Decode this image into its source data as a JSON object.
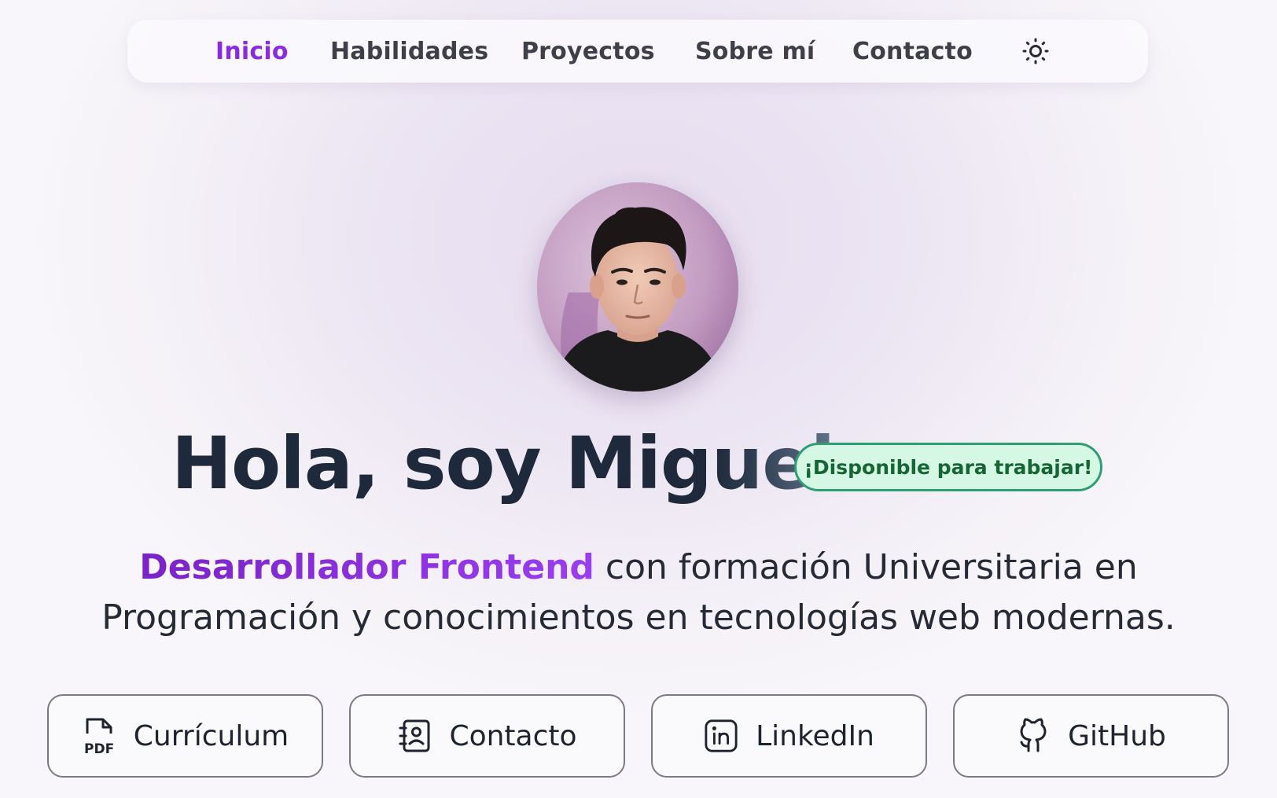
{
  "nav": {
    "items": [
      {
        "label": "Inicio",
        "active": true
      },
      {
        "label": "Habilidades",
        "active": false
      },
      {
        "label": "Proyectos",
        "active": false
      },
      {
        "label": "Sobre mí",
        "active": false
      },
      {
        "label": "Contacto",
        "active": false
      }
    ],
    "theme_icon": "sun-icon"
  },
  "hero": {
    "avatar_icon": "profile-photo",
    "title_prefix": "Hola, soy Mig",
    "title_suffix": "uel",
    "badge": "¡Disponible para trabajar!",
    "role": "Desarrollador Frontend",
    "description": " con formación Universitaria en Programación y conocimientos en tecnologías web modernas."
  },
  "buttons": [
    {
      "label": "Currículum",
      "icon": "pdf-icon"
    },
    {
      "label": "Contacto",
      "icon": "contact-book-icon"
    },
    {
      "label": "LinkedIn",
      "icon": "linkedin-icon"
    },
    {
      "label": "GitHub",
      "icon": "github-icon"
    }
  ],
  "colors": {
    "accent": "#8a2be2",
    "badge_border": "#2f9e73",
    "badge_bg": "#d4f8e4",
    "badge_text": "#166534"
  }
}
